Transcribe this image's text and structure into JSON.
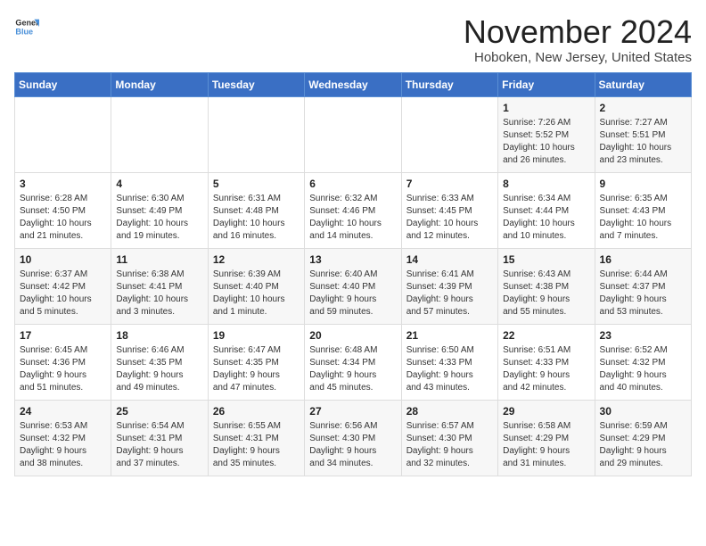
{
  "logo": {
    "line1": "General",
    "line2": "Blue"
  },
  "title": "November 2024",
  "location": "Hoboken, New Jersey, United States",
  "weekdays": [
    "Sunday",
    "Monday",
    "Tuesday",
    "Wednesday",
    "Thursday",
    "Friday",
    "Saturday"
  ],
  "weeks": [
    [
      {
        "day": "",
        "info": ""
      },
      {
        "day": "",
        "info": ""
      },
      {
        "day": "",
        "info": ""
      },
      {
        "day": "",
        "info": ""
      },
      {
        "day": "",
        "info": ""
      },
      {
        "day": "1",
        "info": "Sunrise: 7:26 AM\nSunset: 5:52 PM\nDaylight: 10 hours\nand 26 minutes."
      },
      {
        "day": "2",
        "info": "Sunrise: 7:27 AM\nSunset: 5:51 PM\nDaylight: 10 hours\nand 23 minutes."
      }
    ],
    [
      {
        "day": "3",
        "info": "Sunrise: 6:28 AM\nSunset: 4:50 PM\nDaylight: 10 hours\nand 21 minutes."
      },
      {
        "day": "4",
        "info": "Sunrise: 6:30 AM\nSunset: 4:49 PM\nDaylight: 10 hours\nand 19 minutes."
      },
      {
        "day": "5",
        "info": "Sunrise: 6:31 AM\nSunset: 4:48 PM\nDaylight: 10 hours\nand 16 minutes."
      },
      {
        "day": "6",
        "info": "Sunrise: 6:32 AM\nSunset: 4:46 PM\nDaylight: 10 hours\nand 14 minutes."
      },
      {
        "day": "7",
        "info": "Sunrise: 6:33 AM\nSunset: 4:45 PM\nDaylight: 10 hours\nand 12 minutes."
      },
      {
        "day": "8",
        "info": "Sunrise: 6:34 AM\nSunset: 4:44 PM\nDaylight: 10 hours\nand 10 minutes."
      },
      {
        "day": "9",
        "info": "Sunrise: 6:35 AM\nSunset: 4:43 PM\nDaylight: 10 hours\nand 7 minutes."
      }
    ],
    [
      {
        "day": "10",
        "info": "Sunrise: 6:37 AM\nSunset: 4:42 PM\nDaylight: 10 hours\nand 5 minutes."
      },
      {
        "day": "11",
        "info": "Sunrise: 6:38 AM\nSunset: 4:41 PM\nDaylight: 10 hours\nand 3 minutes."
      },
      {
        "day": "12",
        "info": "Sunrise: 6:39 AM\nSunset: 4:40 PM\nDaylight: 10 hours\nand 1 minute."
      },
      {
        "day": "13",
        "info": "Sunrise: 6:40 AM\nSunset: 4:40 PM\nDaylight: 9 hours\nand 59 minutes."
      },
      {
        "day": "14",
        "info": "Sunrise: 6:41 AM\nSunset: 4:39 PM\nDaylight: 9 hours\nand 57 minutes."
      },
      {
        "day": "15",
        "info": "Sunrise: 6:43 AM\nSunset: 4:38 PM\nDaylight: 9 hours\nand 55 minutes."
      },
      {
        "day": "16",
        "info": "Sunrise: 6:44 AM\nSunset: 4:37 PM\nDaylight: 9 hours\nand 53 minutes."
      }
    ],
    [
      {
        "day": "17",
        "info": "Sunrise: 6:45 AM\nSunset: 4:36 PM\nDaylight: 9 hours\nand 51 minutes."
      },
      {
        "day": "18",
        "info": "Sunrise: 6:46 AM\nSunset: 4:35 PM\nDaylight: 9 hours\nand 49 minutes."
      },
      {
        "day": "19",
        "info": "Sunrise: 6:47 AM\nSunset: 4:35 PM\nDaylight: 9 hours\nand 47 minutes."
      },
      {
        "day": "20",
        "info": "Sunrise: 6:48 AM\nSunset: 4:34 PM\nDaylight: 9 hours\nand 45 minutes."
      },
      {
        "day": "21",
        "info": "Sunrise: 6:50 AM\nSunset: 4:33 PM\nDaylight: 9 hours\nand 43 minutes."
      },
      {
        "day": "22",
        "info": "Sunrise: 6:51 AM\nSunset: 4:33 PM\nDaylight: 9 hours\nand 42 minutes."
      },
      {
        "day": "23",
        "info": "Sunrise: 6:52 AM\nSunset: 4:32 PM\nDaylight: 9 hours\nand 40 minutes."
      }
    ],
    [
      {
        "day": "24",
        "info": "Sunrise: 6:53 AM\nSunset: 4:32 PM\nDaylight: 9 hours\nand 38 minutes."
      },
      {
        "day": "25",
        "info": "Sunrise: 6:54 AM\nSunset: 4:31 PM\nDaylight: 9 hours\nand 37 minutes."
      },
      {
        "day": "26",
        "info": "Sunrise: 6:55 AM\nSunset: 4:31 PM\nDaylight: 9 hours\nand 35 minutes."
      },
      {
        "day": "27",
        "info": "Sunrise: 6:56 AM\nSunset: 4:30 PM\nDaylight: 9 hours\nand 34 minutes."
      },
      {
        "day": "28",
        "info": "Sunrise: 6:57 AM\nSunset: 4:30 PM\nDaylight: 9 hours\nand 32 minutes."
      },
      {
        "day": "29",
        "info": "Sunrise: 6:58 AM\nSunset: 4:29 PM\nDaylight: 9 hours\nand 31 minutes."
      },
      {
        "day": "30",
        "info": "Sunrise: 6:59 AM\nSunset: 4:29 PM\nDaylight: 9 hours\nand 29 minutes."
      }
    ]
  ]
}
